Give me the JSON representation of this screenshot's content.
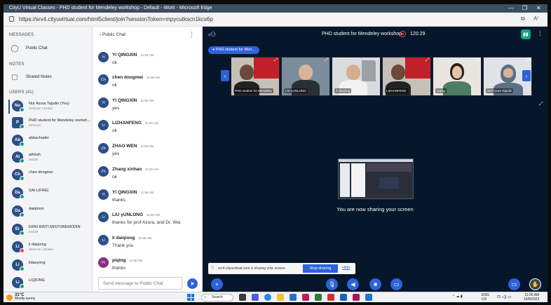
{
  "browser": {
    "title": "CityU Virtual Classes - PHD student for Mendeley workshop - Default - Work - Microsoft Edge",
    "url": "https://srv4.cityuvirtual.com/html5client/join?sessionToken=mpycutkscn1kcs6p",
    "controls": [
      "—",
      "❐",
      "✕"
    ]
  },
  "left_panel": {
    "messages_heading": "MESSAGES",
    "public_chat": "Public Chat",
    "notes_heading": "NOTES",
    "shared_notes": "Shared Notes",
    "users_heading": "USERS (41)",
    "users": [
      {
        "initials": "Nu",
        "name": "Nur Azura Tajudin (You)",
        "sub": "Webcam | Mobile"
      },
      {
        "initials": "P",
        "name": "PHD student for Mendeley worksh...",
        "sub": "Webcam"
      },
      {
        "initials": "Ab",
        "name": "abbachader",
        "sub": ""
      },
      {
        "initials": "At",
        "name": "athirah",
        "sub": "Mobile"
      },
      {
        "initials": "Ch",
        "name": "chen dongmei",
        "sub": ""
      },
      {
        "initials": "Da",
        "name": "DAI LIFING",
        "sub": ""
      },
      {
        "initials": "Da",
        "name": "daiqinxin",
        "sub": ""
      },
      {
        "initials": "Er",
        "name": "ERNI BINTI MISTOREMODIN",
        "sub": "Mobile"
      },
      {
        "initials": "Li",
        "name": "li daiqiong",
        "sub": "Webcam | Mobile"
      },
      {
        "initials": "Li",
        "name": "lidaoyong",
        "sub": ""
      },
      {
        "initials": "Li",
        "name": "LIQIONG",
        "sub": ""
      }
    ]
  },
  "chat": {
    "header": "Public Chat",
    "menu_icon": "⋮",
    "messages": [
      {
        "initials": "Yi",
        "name": "YI QINGXIN",
        "time": "11:54 AM",
        "text": "ok"
      },
      {
        "initials": "Ch",
        "name": "chen dongmei",
        "time": "11:55 AM",
        "text": "ok"
      },
      {
        "initials": "Yi",
        "name": "YI QINGXIN",
        "time": "11:55 AM",
        "text": "yes"
      },
      {
        "initials": "Li",
        "name": "LIZHANFENG",
        "time": "11:55 AM",
        "text": "ok"
      },
      {
        "initials": "Zh",
        "name": "ZHAO WEN",
        "time": "11:55 AM",
        "text": "yes"
      },
      {
        "initials": "Zh",
        "name": "Zhang xinhao",
        "time": "11:55 AM",
        "text": "ok"
      },
      {
        "initials": "Yi",
        "name": "YI QINGXIN",
        "time": "11:56 AM",
        "text": "thanks"
      },
      {
        "initials": "Li",
        "name": "LIU yUNLONG",
        "time": "11:56 AM",
        "text": "thanks for prof Azura, and Dr. Wei."
      },
      {
        "initials": "Li",
        "name": "li daiqiong",
        "time": "11:56 AM",
        "text": "Thank you"
      },
      {
        "initials": "Pi",
        "name": "piqing",
        "time": "11:56 AM",
        "text": "thanks"
      }
    ],
    "input_placeholder": "Send message to Public Chat"
  },
  "meeting": {
    "title": "PHD student for Mendeley workshop",
    "timer": "120:29",
    "presenter_pill": "PHD student for Men...",
    "webcams": [
      {
        "label": "PHD student for Mendeley"
      },
      {
        "label": "LIU yUNLONG"
      },
      {
        "label": "li daiqiong"
      },
      {
        "label": "LIZHANFENG"
      },
      {
        "label": "piqing"
      },
      {
        "label": "Nur Azura Tajudin"
      }
    ],
    "share_text": "You are now sharing your screen",
    "notice_text": "srv4.cityuvirtual.com is sharing your screen.",
    "stop_sharing": "Stop sharing",
    "hide": "Hide"
  },
  "taskbar": {
    "temp": "31°C",
    "weather": "Mostly sunny",
    "search": "Search",
    "lang": "ENG US",
    "time": "11:56 AM",
    "date": "16/8/2023"
  }
}
